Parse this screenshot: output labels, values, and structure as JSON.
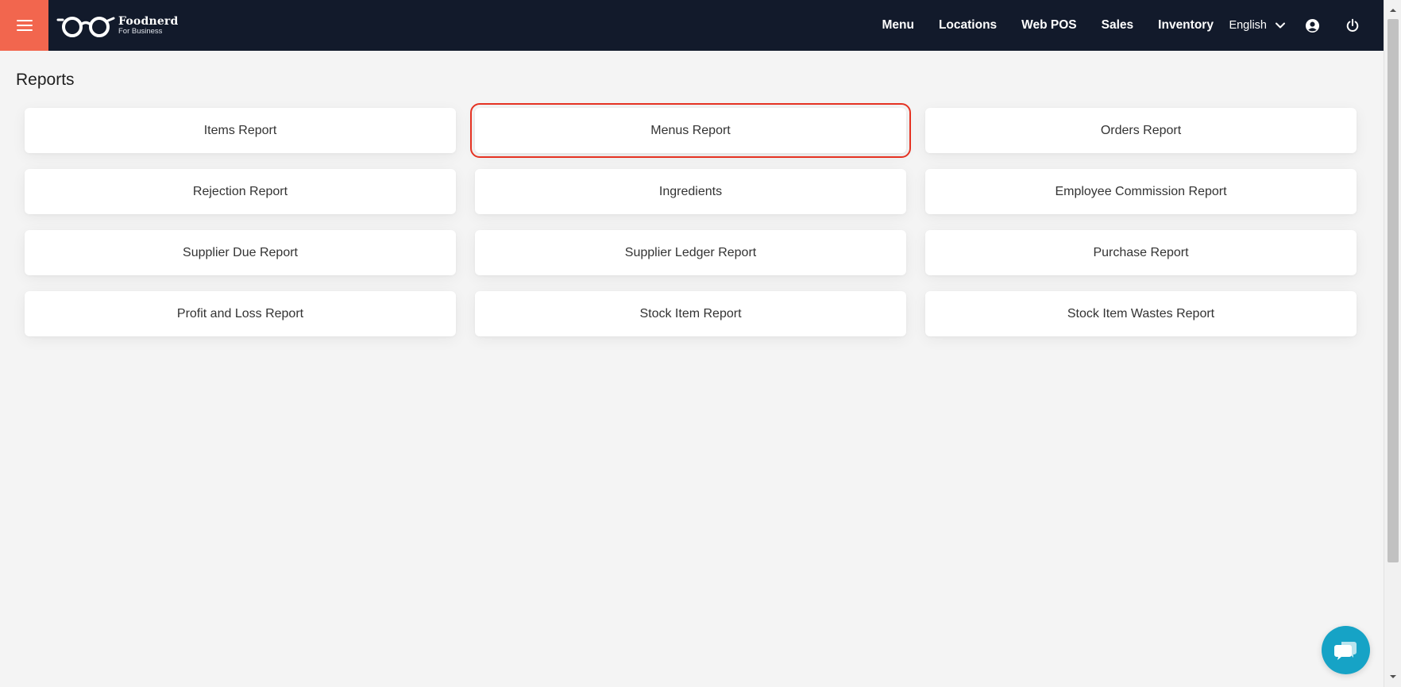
{
  "brand": {
    "name": "Foodnerd",
    "tagline": "For Business",
    "menu_icon": "hamburger-menu-icon",
    "logo_icon": "glasses-logo-icon",
    "accent_color": "#f2664e",
    "header_color": "#121a2b"
  },
  "nav": {
    "items": [
      {
        "label": "Menu"
      },
      {
        "label": "Locations"
      },
      {
        "label": "Web POS"
      },
      {
        "label": "Sales"
      },
      {
        "label": "Inventory"
      }
    ],
    "language": {
      "label": "English",
      "icon": "chevron-down-icon"
    },
    "account_icon": "user-circle-icon",
    "logout_icon": "power-icon"
  },
  "page": {
    "title": "Reports"
  },
  "reports": {
    "highlight_color": "#e53222",
    "cards": [
      {
        "label": "Items Report",
        "highlighted": false
      },
      {
        "label": "Menus Report",
        "highlighted": true
      },
      {
        "label": "Orders Report",
        "highlighted": false
      },
      {
        "label": "Rejection Report",
        "highlighted": false
      },
      {
        "label": "Ingredients",
        "highlighted": false
      },
      {
        "label": "Employee Commission Report",
        "highlighted": false
      },
      {
        "label": "Supplier Due Report",
        "highlighted": false
      },
      {
        "label": "Supplier Ledger Report",
        "highlighted": false
      },
      {
        "label": "Purchase Report",
        "highlighted": false
      },
      {
        "label": "Profit and Loss Report",
        "highlighted": false
      },
      {
        "label": "Stock Item Report",
        "highlighted": false
      },
      {
        "label": "Stock Item Wastes Report",
        "highlighted": false
      }
    ]
  },
  "chat": {
    "icon": "chat-bubble-icon",
    "color": "#16a3c6"
  }
}
